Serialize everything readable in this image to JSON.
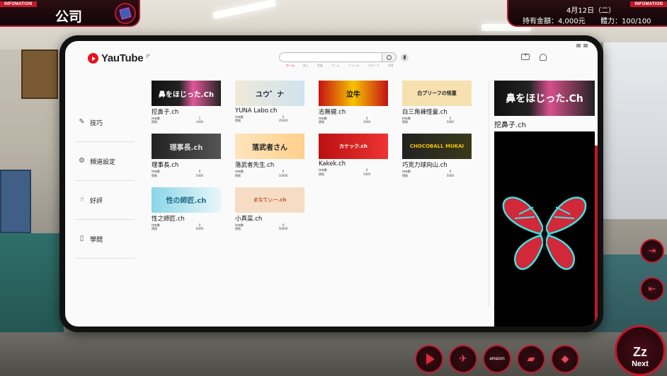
{
  "hud": {
    "left_tag": "INFOMATION",
    "company_label": "公司",
    "right_tag": "INFOMATION",
    "date": "4月12日（二）",
    "money": "持有金額：4,000元",
    "stamina": "體力：100/100"
  },
  "youtube": {
    "logo": "YauTube",
    "region": "JP",
    "search_placeholder": "",
    "nav_tabs": [
      "ホーム",
      "急上",
      "音楽",
      "ゲーム",
      "ニュース",
      "スポーツ",
      "学習"
    ],
    "icons": {
      "upload": "video-upload-icon",
      "bell": "notification-bell-icon",
      "search": "search-icon",
      "mic": "mic-icon"
    }
  },
  "sidebar": {
    "items": [
      {
        "label": "技巧",
        "icon": "wrench-icon",
        "glyph": "✎"
      },
      {
        "label": "頻道設定",
        "icon": "gear-icon",
        "glyph": "⚙"
      },
      {
        "label": "好評",
        "icon": "thumbs-up-icon",
        "glyph": "☝"
      },
      {
        "label": "學問",
        "icon": "book-icon",
        "glyph": "▯"
      }
    ]
  },
  "channels": [
    {
      "thumb": "鼻をほじった.Ch",
      "name": "挖鼻子.ch",
      "subs_label": "持有數",
      "subs": "1",
      "price_label": "價格",
      "price": "1000"
    },
    {
      "thumb": "ユウ゛ナ",
      "name": "YUNA Labo.ch",
      "subs_label": "持有數",
      "subs": "0",
      "price_label": "價格",
      "price": "35000"
    },
    {
      "thumb": "泣牛",
      "name": "志無健.ch",
      "subs_label": "持有數",
      "subs": "0",
      "price_label": "價格",
      "price": "1000"
    },
    {
      "thumb": "白ブリーフの怪童",
      "name": "白三角褲怪童.ch",
      "subs_label": "持有數",
      "subs": "0",
      "price_label": "價格",
      "price": "5000"
    },
    {
      "thumb": "理事長.ch",
      "name": "理事長.ch",
      "subs_label": "持有數",
      "subs": "0",
      "price_label": "價格",
      "price": "5000"
    },
    {
      "thumb": "落武者さん",
      "name": "落武者先生.ch",
      "subs_label": "持有數",
      "subs": "0",
      "price_label": "價格",
      "price": "10000"
    },
    {
      "thumb": "カケック.ch",
      "name": "Kakek.ch",
      "subs_label": "持有數",
      "subs": "0",
      "price_label": "價格",
      "price": "1000"
    },
    {
      "thumb": "CHOCOBALL MUKAI",
      "name": "巧克力球向山.ch",
      "subs_label": "持有數",
      "subs": "0",
      "price_label": "價格",
      "price": "5000"
    },
    {
      "thumb": "性の師匠.ch",
      "name": "性之師匠.ch",
      "subs_label": "持有數",
      "subs": "0",
      "price_label": "價格",
      "price": "6000"
    },
    {
      "thumb": "まなてぃー.ch",
      "name": "小真菜.ch",
      "subs_label": "持有數",
      "subs": "0",
      "price_label": "價格",
      "price": "50000"
    }
  ],
  "preview": {
    "banner": "鼻をほじった.Ch",
    "name": "挖鼻子.ch"
  },
  "dock": {
    "amazon_label": "amazon",
    "next_label": "Next",
    "next_glyph": "Zz"
  },
  "colors": {
    "accent_red": "#c4172a",
    "hud_dark": "#120508",
    "youtube_red": "#e6121b",
    "butterfly_red": "#d1283a",
    "butterfly_cyan": "#41e2e0"
  }
}
